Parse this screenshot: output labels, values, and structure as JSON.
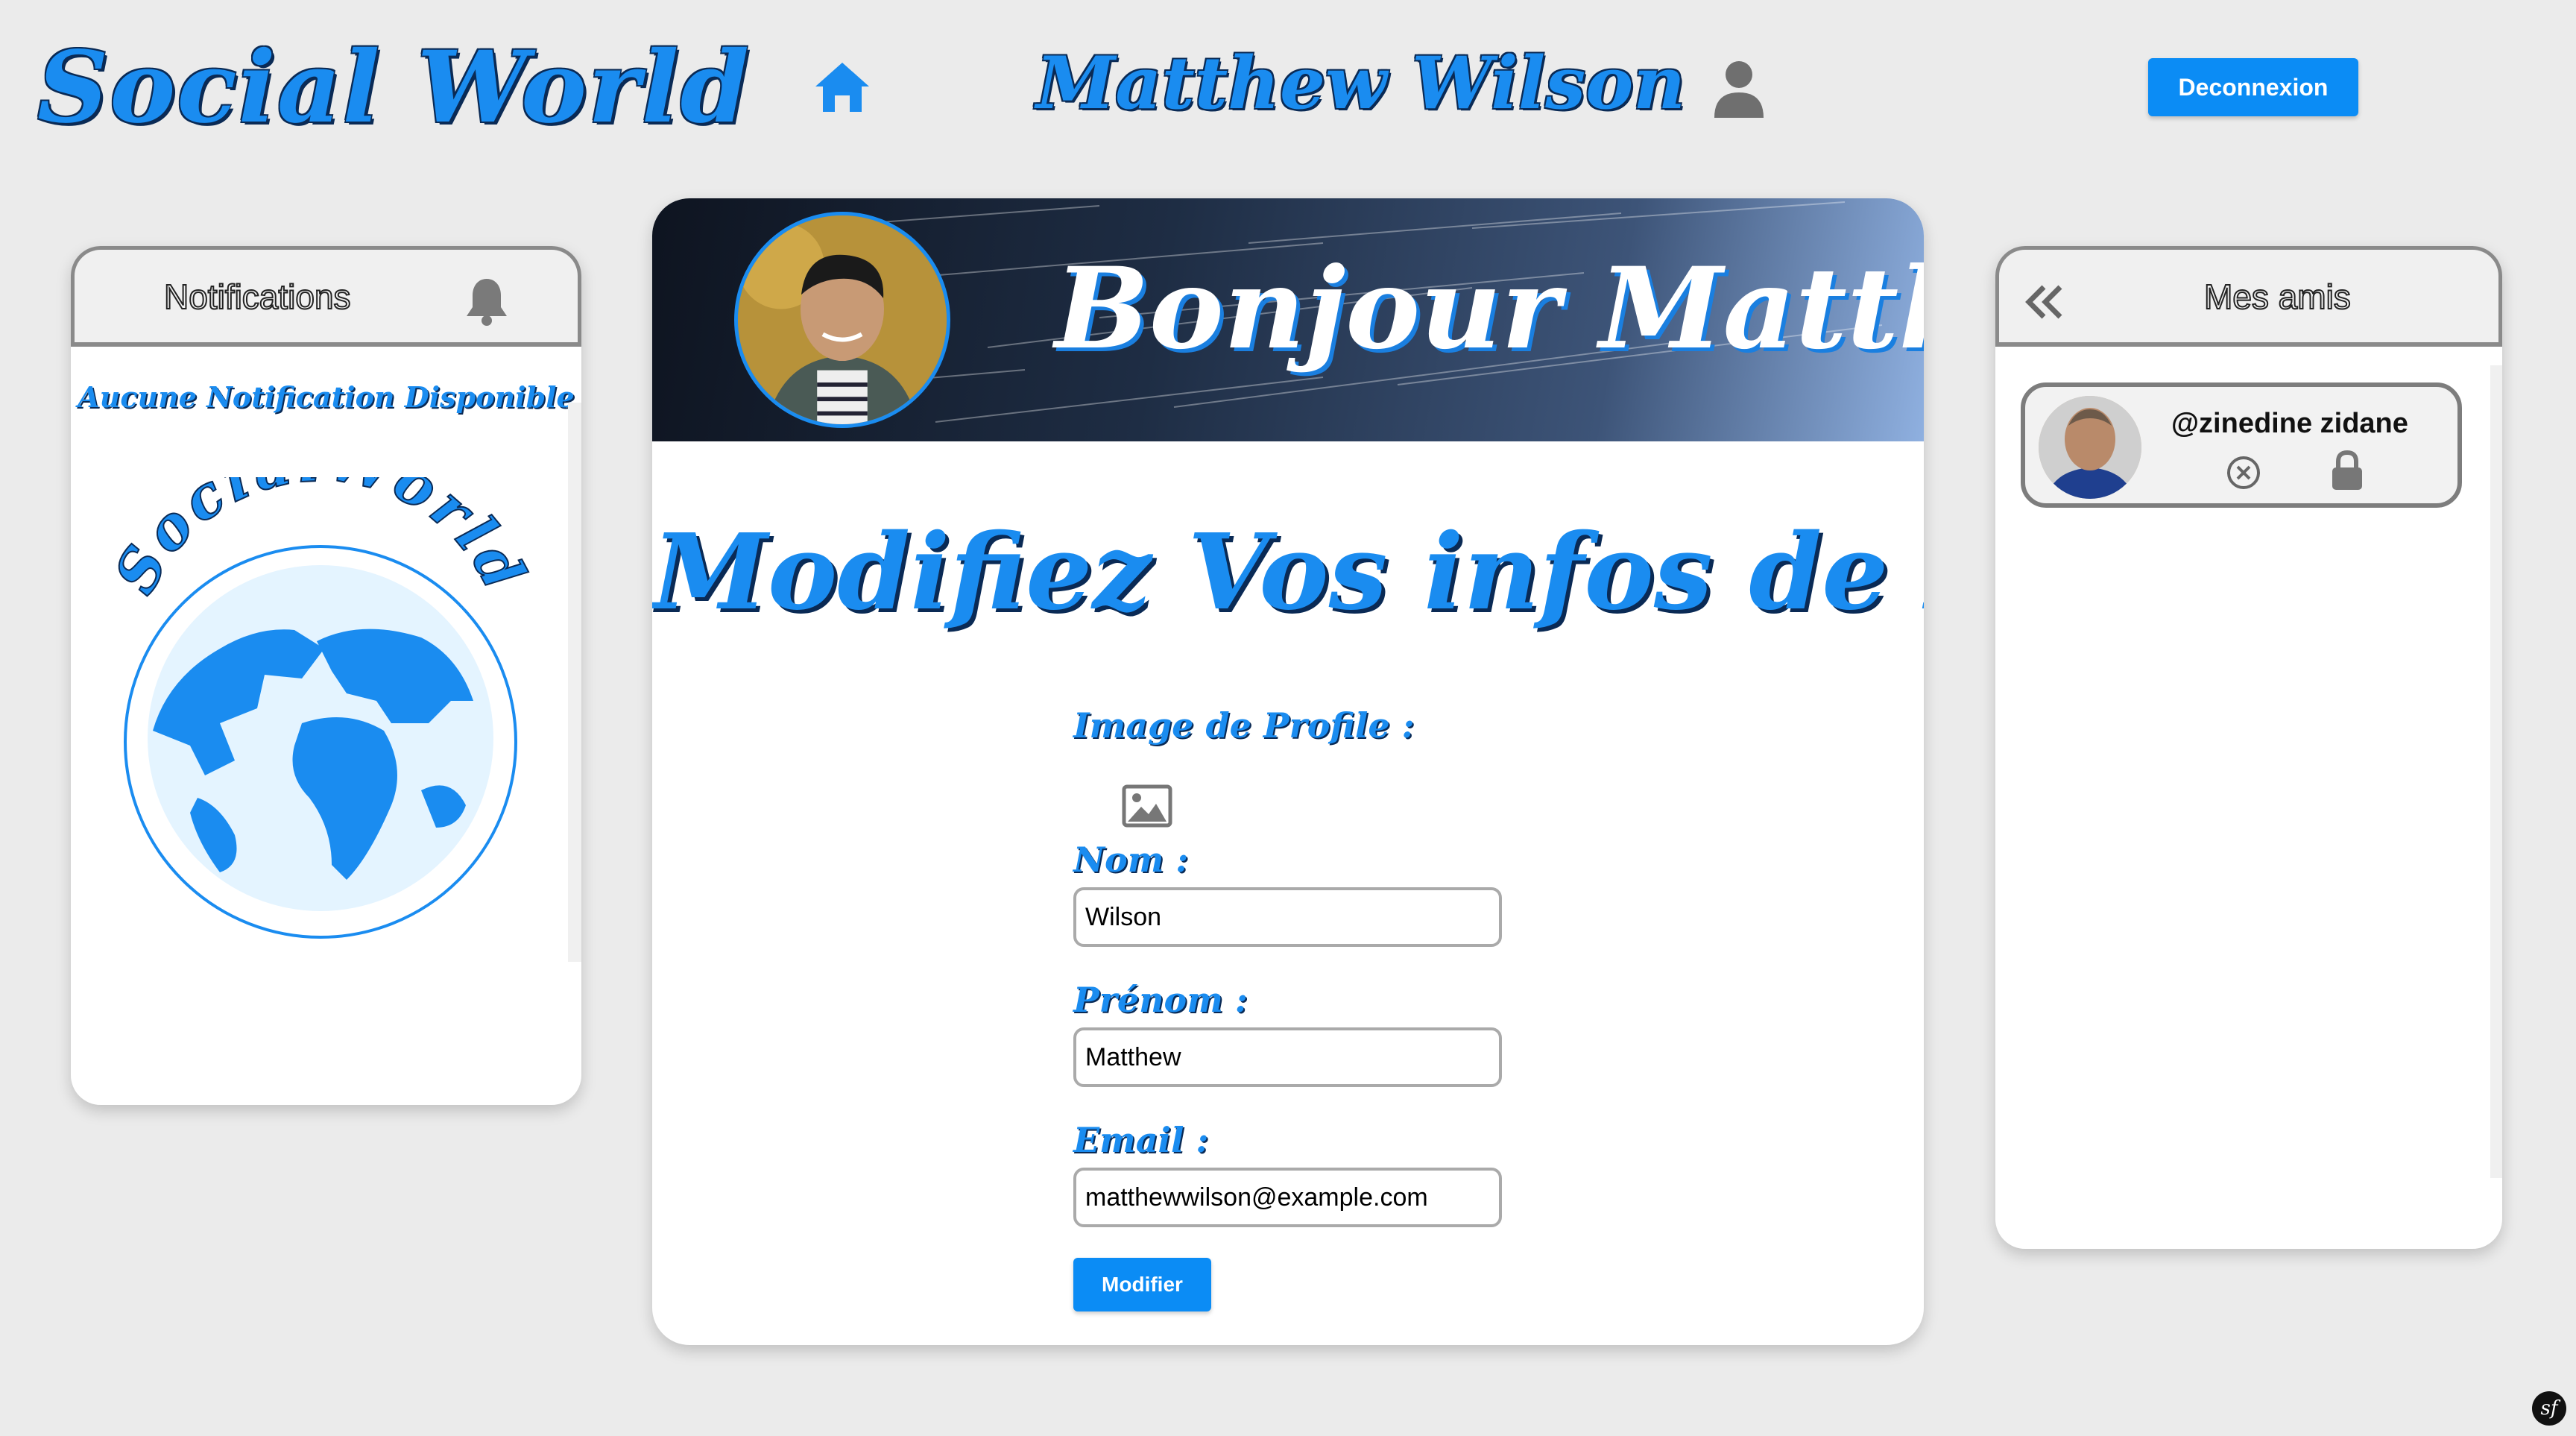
{
  "header": {
    "brand": "Social World",
    "username": "Matthew Wilson",
    "logout_label": "Deconnexion",
    "icons": {
      "home": "home-icon",
      "profile": "user-icon"
    }
  },
  "notifications": {
    "title": "Notifications",
    "empty_message": "Aucune Notification Disponible",
    "icon": "bell-icon",
    "logo_text": "SocialWorld"
  },
  "friends": {
    "title": "Mes amis",
    "back_icon": "double-chevron-left-icon",
    "items": [
      {
        "name": "@zinedine zidane",
        "icons": [
          "remove-circle-icon",
          "lock-icon"
        ]
      }
    ]
  },
  "main": {
    "greeting": "Bonjour Matthew",
    "form_title": "Modifiez Vos infos de Profil",
    "fields": {
      "image_label": "Image de Profile :",
      "nom_label": "Nom :",
      "nom_value": "Wilson",
      "prenom_label": "Prénom :",
      "prenom_value": "Matthew",
      "email_label": "Email :",
      "email_value": "matthewwilson@example.com"
    },
    "submit_label": "Modifier"
  },
  "badge": {
    "text": "sf"
  },
  "colors": {
    "accent": "#1a8cf0",
    "button": "#0b8cf5",
    "background": "#ebebeb",
    "outline": "#0a2a55"
  }
}
